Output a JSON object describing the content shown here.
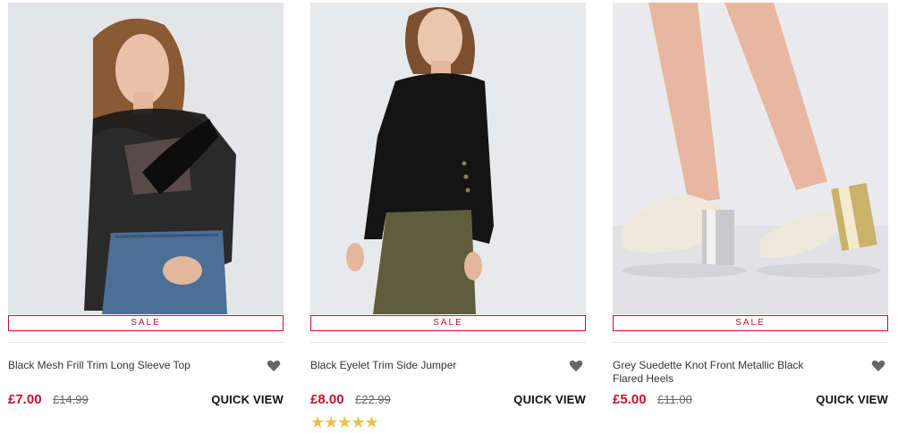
{
  "products": [
    {
      "image_alt": "Black Mesh Frill Trim Long Sleeve Top",
      "sale_label": "SALE",
      "name": "Black Mesh Frill Trim Long Sleeve Top",
      "price": "£7.00",
      "was_price": "£14.99",
      "quick_view": "QUICK VIEW",
      "wishlist_icon": "heart-icon"
    },
    {
      "image_alt": "Black Eyelet Trim Side Jumper",
      "sale_label": "SALE",
      "name": "Black Eyelet Trim Side Jumper",
      "price": "£8.00",
      "was_price": "£22.99",
      "quick_view": "QUICK VIEW",
      "wishlist_icon": "heart-icon",
      "rating": {
        "stars": "★★★★★",
        "value": 5,
        "max": 5
      }
    },
    {
      "image_alt": "Grey Suedette Knot Front Metallic Black Flared Heels",
      "sale_label": "SALE",
      "name": "Grey Suedette Knot Front Metallic Black Flared Heels",
      "price": "£5.00",
      "was_price": "£11.00",
      "quick_view": "QUICK VIEW",
      "wishlist_icon": "heart-icon"
    }
  ],
  "colors": {
    "sale_red": "#c8102e",
    "star_gold": "#e8c24a",
    "wishlist_grey": "#666666"
  }
}
